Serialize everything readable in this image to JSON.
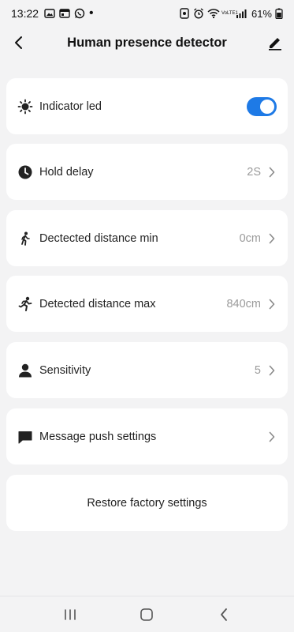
{
  "status_bar": {
    "time": "13:22",
    "battery": "61%",
    "dot": "•",
    "network": "VoLTE1"
  },
  "header": {
    "title": "Human presence detector"
  },
  "settings": [
    {
      "label": "Indicator led",
      "icon": "sun-icon",
      "toggle": true
    },
    {
      "label": "Hold delay",
      "icon": "clock-icon",
      "value": "2S"
    },
    {
      "label": "Dectected distance min",
      "icon": "walking-person-icon",
      "value": "0cm"
    },
    {
      "label": "Detected distance max",
      "icon": "running-person-icon",
      "value": "840cm"
    },
    {
      "label": "Sensitivity",
      "icon": "person-icon",
      "value": "5"
    },
    {
      "label": "Message push settings",
      "icon": "message-icon",
      "value": ""
    }
  ],
  "restore": {
    "label": "Restore factory settings"
  },
  "colors": {
    "accent": "#1e7ae6",
    "background": "#f3f3f4",
    "card": "#ffffff",
    "muted_text": "#9a9a9a"
  }
}
